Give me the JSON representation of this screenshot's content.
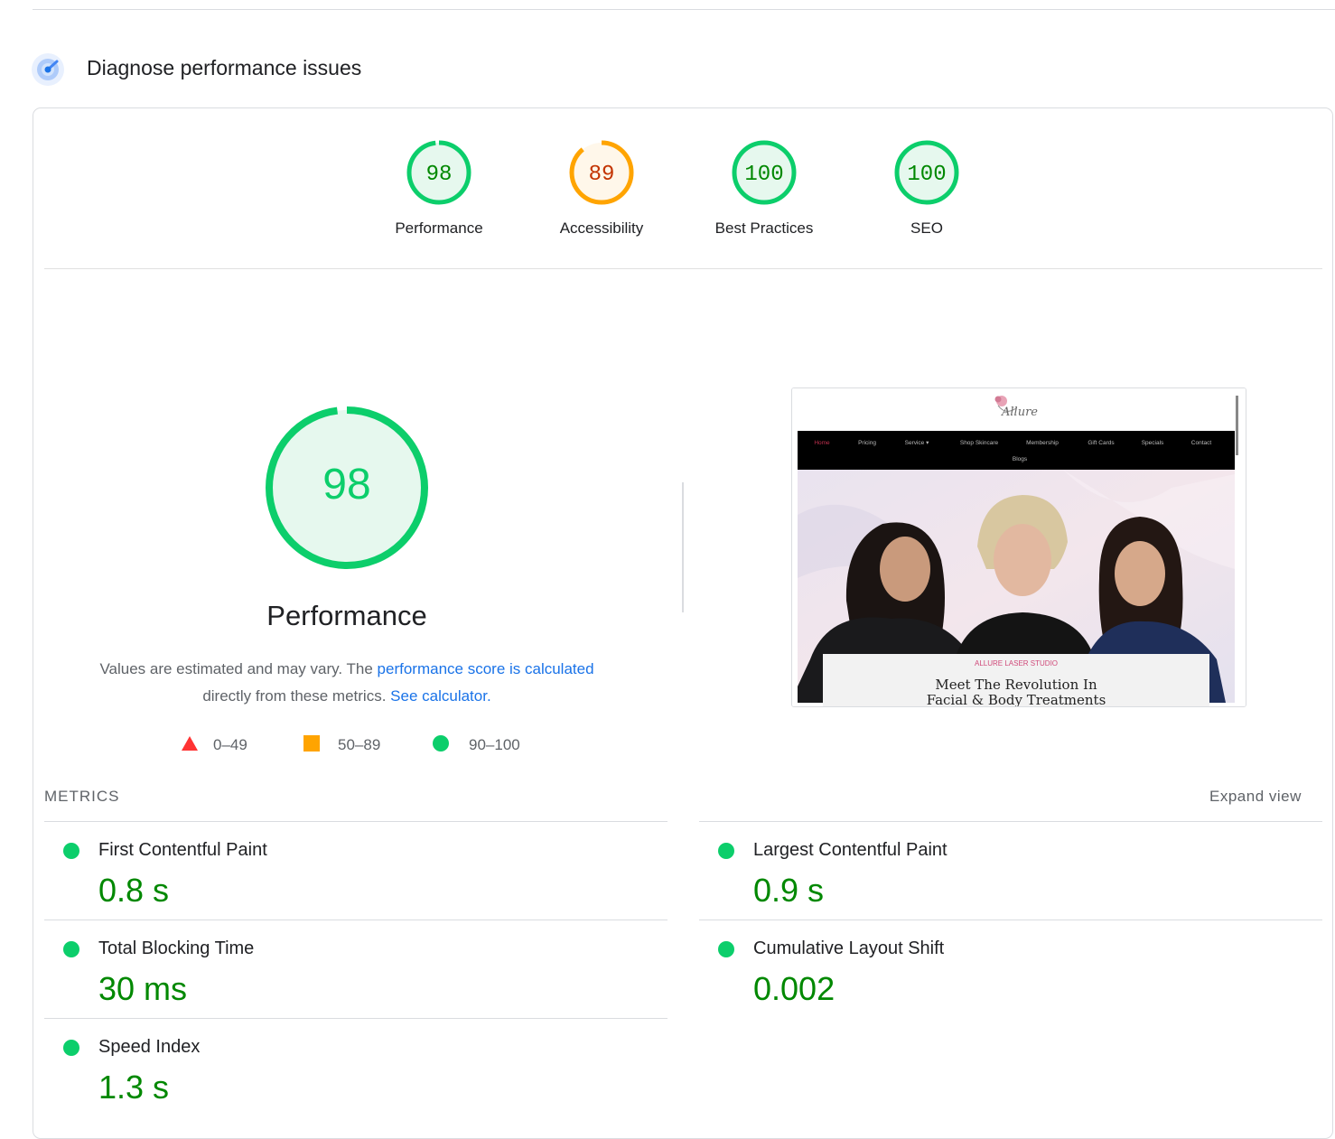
{
  "section": {
    "title": "Diagnose performance issues",
    "icon": "lighthouse-icon"
  },
  "categories": [
    {
      "label": "Performance",
      "score": "98",
      "value": 98,
      "rating": "pass"
    },
    {
      "label": "Accessibility",
      "score": "89",
      "value": 89,
      "rating": "average"
    },
    {
      "label": "Best Practices",
      "score": "100",
      "value": 100,
      "rating": "pass"
    },
    {
      "label": "SEO",
      "score": "100",
      "value": 100,
      "rating": "pass"
    }
  ],
  "performance": {
    "score": "98",
    "value": 98,
    "title": "Performance",
    "note_text_1": "Values are estimated and may vary. The ",
    "note_link_1": "performance score is calculated",
    "note_text_2": "directly from these metrics. ",
    "note_link_2": "See calculator."
  },
  "legend": [
    {
      "range": "0–49",
      "shape": "triangle",
      "color": "#ff3333"
    },
    {
      "range": "50–89",
      "shape": "square",
      "color": "#ffa400"
    },
    {
      "range": "90–100",
      "shape": "circle",
      "color": "#0cce6b"
    }
  ],
  "screenshot": {
    "brand": "Allure",
    "nav": [
      "Home",
      "Pricing",
      "Service ▾",
      "Shop Skincare",
      "Membership",
      "Gift Cards",
      "Specials",
      "Contact"
    ],
    "nav2": "Blogs",
    "studio": "ALLURE LASER STUDIO",
    "headline": "Meet The Revolution In",
    "headline2": "Facial & Body Treatments"
  },
  "metrics": {
    "heading": "METRICS",
    "expand": "Expand view",
    "items": [
      {
        "name": "First Contentful Paint",
        "value": "0.8 s"
      },
      {
        "name": "Largest Contentful Paint",
        "value": "0.9 s"
      },
      {
        "name": "Total Blocking Time",
        "value": "30 ms"
      },
      {
        "name": "Cumulative Layout Shift",
        "value": "0.002"
      },
      {
        "name": "Speed Index",
        "value": "1.3 s"
      }
    ]
  },
  "colors": {
    "pass": "#0cce6b",
    "pass_text": "#008800",
    "pass_fill": "#e6f8ee",
    "average": "#ffa400",
    "average_text": "#c33300",
    "average_fill": "#fff7ea",
    "link": "#1a73e8"
  }
}
